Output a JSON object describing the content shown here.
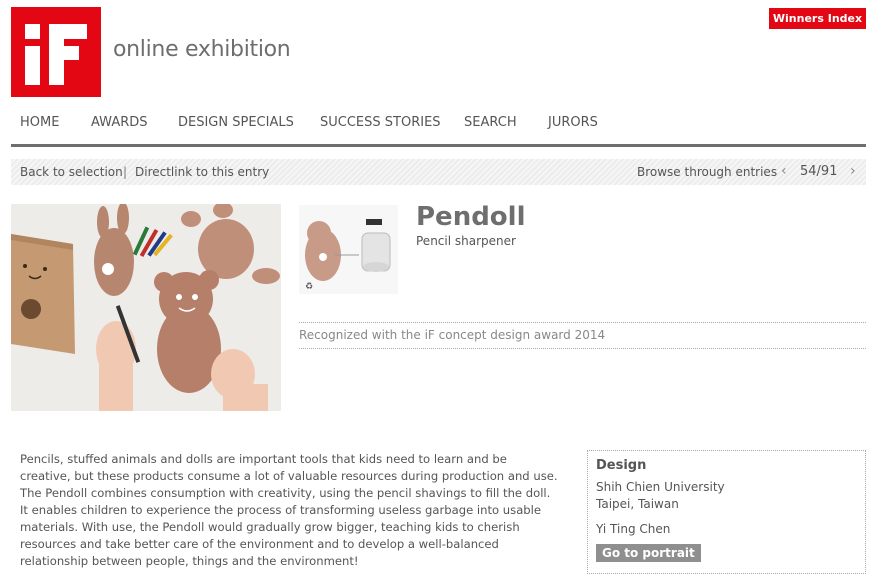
{
  "header": {
    "site_title": "online exhibition",
    "winners_button": "Winners Index"
  },
  "nav": {
    "items": [
      "HOME",
      "AWARDS",
      "DESIGN SPECIALS",
      "SUCCESS STORIES",
      "SEARCH",
      "JURORS"
    ]
  },
  "subbar": {
    "back_link": "Back to selection",
    "separator": "|",
    "direct_link": "Directlink to this entry",
    "browse_label": "Browse through entries",
    "counter": "54/91"
  },
  "entry": {
    "name": "Pendoll",
    "category": "Pencil sharpener",
    "award_text": "Recognized with the iF concept design award 2014",
    "description": "Pencils, stuffed animals and dolls are important tools that kids need to learn and be creative, but these products consume a lot of valuable resources during production and use. The Pendoll combines consumption with creativity, using the pencil shavings to fill the doll. It enables children to experience the process of transforming useless garbage into usable materials. With use, the Pendoll would gradually grow bigger, teaching kids to cherish resources and take better care of the environment and to develop a well-balanced relationship between people, things and the environment!"
  },
  "design": {
    "title": "Design",
    "org": "Shih Chien University",
    "location": "Taipei, Taiwan",
    "person": "Yi Ting Chen",
    "portrait_button": "Go to portrait"
  },
  "colors": {
    "brand_red": "#e30613",
    "nav_rule": "#6e6e6e",
    "button_gray": "#8f8f8f"
  },
  "icons": {
    "prev": "chevron-left-icon",
    "next": "chevron-right-icon"
  }
}
